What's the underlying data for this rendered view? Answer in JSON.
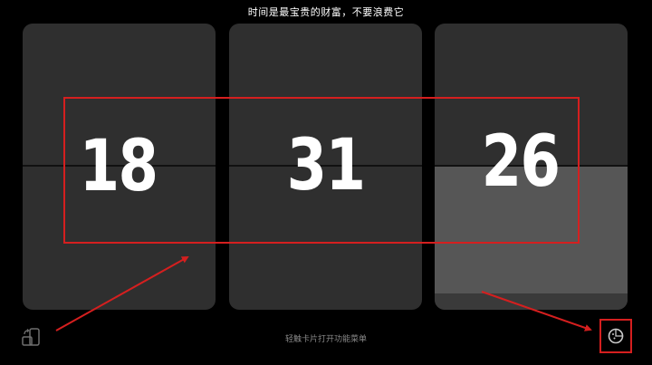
{
  "header": {
    "quote": "时间是最宝贵的财富，不要浪费它"
  },
  "clock": {
    "hours": "18",
    "minutes": "31",
    "seconds": "26"
  },
  "footer": {
    "hint": "轻触卡片打开功能菜单",
    "rotate_icon": "rotate-screen-icon",
    "theme_icon": "palette-icon"
  },
  "annotations": {
    "color": "#d51f1f"
  }
}
